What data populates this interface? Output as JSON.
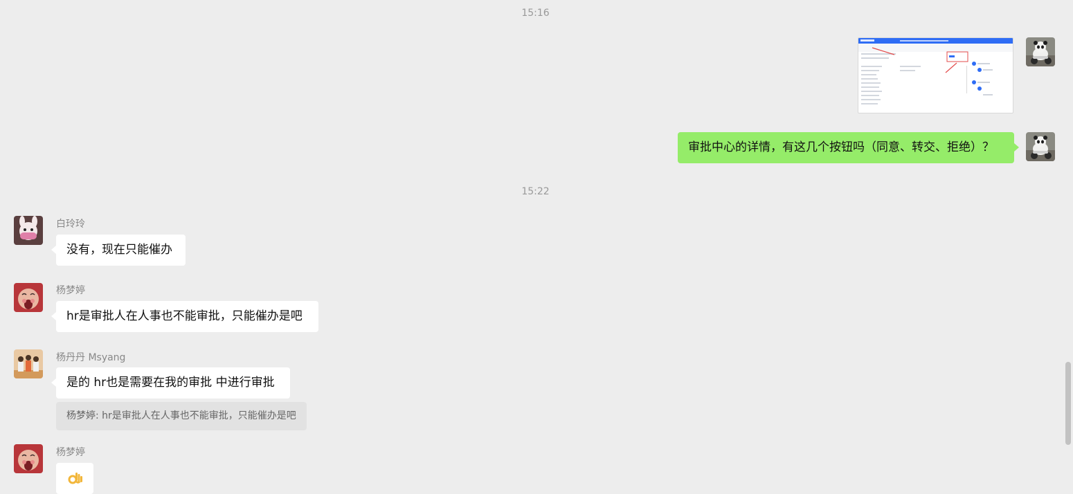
{
  "timestamps": [
    "15:16",
    "15:22"
  ],
  "messages": {
    "m1": {
      "type": "image",
      "side": "right",
      "image_icon": "screenshot-thumbnail"
    },
    "m2": {
      "type": "text",
      "side": "right",
      "text": "审批中心的详情，有这几个按钮吗（同意、转交、拒绝）？"
    },
    "m3": {
      "type": "text",
      "side": "left",
      "sender": "白玲玲",
      "text": "没有，现在只能催办"
    },
    "m4": {
      "type": "text",
      "side": "left",
      "sender": "杨梦婷",
      "text": "hr是审批人在人事也不能审批，只能催办是吧"
    },
    "m5": {
      "type": "text",
      "side": "left",
      "sender": "杨丹丹 Msyang",
      "text": "是的 hr也是需要在我的审批 中进行审批",
      "quote": "杨梦婷: hr是审批人在人事也不能审批，只能催办是吧"
    },
    "m6": {
      "type": "emoji",
      "side": "left",
      "sender": "杨梦婷",
      "emoji_icon": "ok-hand-emoji-icon"
    }
  },
  "colors": {
    "background": "#ededed",
    "self_bubble": "#95ec69",
    "other_bubble": "#ffffff",
    "quote_bg": "#e2e2e2"
  }
}
